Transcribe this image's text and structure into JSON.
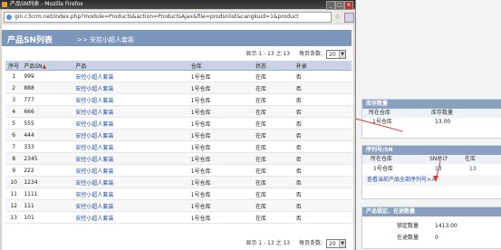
{
  "window": {
    "title": "产品SN列表 - Mozilla Firefox",
    "url": "gin.c3crm.net/index.php?module=Products&action=ProductsAjax&file=prodsnlist&cangkuid=1&product"
  },
  "header": {
    "title": "产品SN列表",
    "sep": ">>",
    "product": "安控小超人套装"
  },
  "pager": {
    "display": "显示 1 - 13 之 13",
    "per_page_label": "每页条数:",
    "per_page_value": "20",
    "dropdown_arrow": "▼"
  },
  "table": {
    "columns": [
      "序号",
      "产品SN",
      "产品",
      "仓库",
      "状态",
      "补录"
    ],
    "sort_arrow": "▲",
    "rows": [
      {
        "no": "1",
        "sn": "999",
        "product": "安控小超人套装",
        "store": "1号仓库",
        "status": "在库",
        "rec": "否"
      },
      {
        "no": "2",
        "sn": "888",
        "product": "安控小超人套装",
        "store": "1号仓库",
        "status": "在库",
        "rec": "否"
      },
      {
        "no": "3",
        "sn": "777",
        "product": "安控小超人套装",
        "store": "1号仓库",
        "status": "在库",
        "rec": "否"
      },
      {
        "no": "4",
        "sn": "666",
        "product": "安控小超人套装",
        "store": "1号仓库",
        "status": "在库",
        "rec": "否"
      },
      {
        "no": "5",
        "sn": "555",
        "product": "安控小超人套装",
        "store": "1号仓库",
        "status": "在库",
        "rec": "否"
      },
      {
        "no": "6",
        "sn": "444",
        "product": "安控小超人套装",
        "store": "1号仓库",
        "status": "在库",
        "rec": "否"
      },
      {
        "no": "7",
        "sn": "333",
        "product": "安控小超人套装",
        "store": "1号仓库",
        "status": "在库",
        "rec": "否"
      },
      {
        "no": "8",
        "sn": "2345",
        "product": "安控小超人套装",
        "store": "1号仓库",
        "status": "在库",
        "rec": "否"
      },
      {
        "no": "9",
        "sn": "222",
        "product": "安控小超人套装",
        "store": "1号仓库",
        "status": "在库",
        "rec": "否"
      },
      {
        "no": "10",
        "sn": "1234",
        "product": "安控小超人套装",
        "store": "1号仓库",
        "status": "在库",
        "rec": "否"
      },
      {
        "no": "11",
        "sn": "1111",
        "product": "安控小超人套装",
        "store": "1号仓库",
        "status": "在库",
        "rec": "否"
      },
      {
        "no": "12",
        "sn": "111",
        "product": "安控小超人套装",
        "store": "1号仓库",
        "status": "在库",
        "rec": "否"
      },
      {
        "no": "13",
        "sn": "101",
        "product": "安控小超人套装",
        "store": "1号仓库",
        "status": "在库",
        "rec": "否"
      }
    ]
  },
  "inventory": {
    "title": "库存数量",
    "col1": "所在仓库",
    "col2": "库存数量",
    "store": "1号仓库",
    "qty": "13.00"
  },
  "serials": {
    "title": "序列号/SN",
    "col1": "所在仓库",
    "col2": "SN总计",
    "col3": "在库",
    "store": "1号仓库",
    "total": "13",
    "instock": "13",
    "link": "查看当前产品全部序列号>>"
  },
  "locked": {
    "title": "产品锁定、在途数量",
    "label1": "锁定数量",
    "val1": "1413.00",
    "label2": "在途数量",
    "val2": "0"
  },
  "colors": {
    "header_bg": "#7d96bc",
    "grid_header": "#c8d4e6",
    "link": "#1a4c9c",
    "annotation": "#d63a3a"
  }
}
